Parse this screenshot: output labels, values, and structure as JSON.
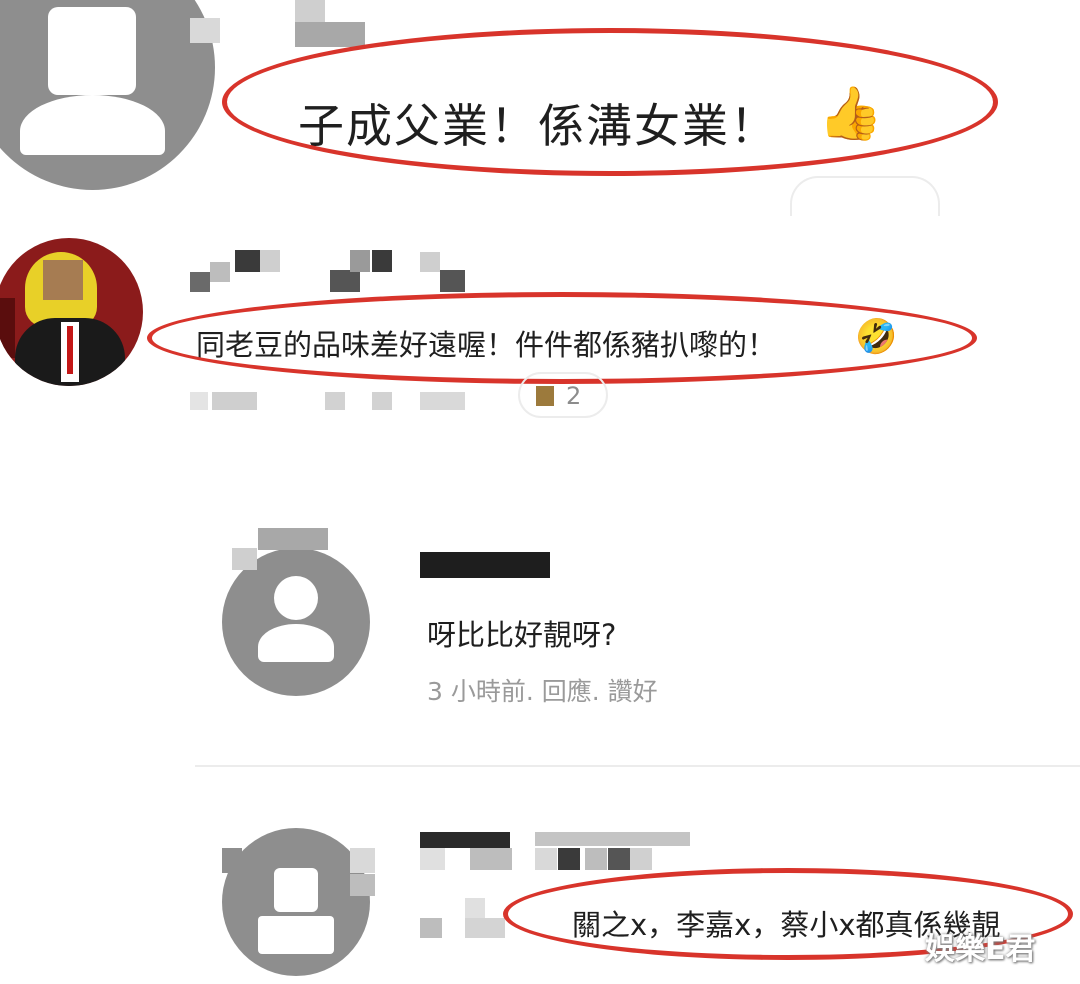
{
  "comments": [
    {
      "text": "子成父業！係溝女業！",
      "emoji": "👍"
    },
    {
      "text": "同老豆的品味差好遠喔！件件都係豬扒嚟的！",
      "emoji": "🤣",
      "reaction_count": "2"
    }
  ],
  "replies": [
    {
      "text": "呀比比好靚呀?",
      "meta": "3 小時前.  回應.  讚好"
    },
    {
      "text": "關之x，李嘉x，蔡小x都真係幾靚"
    }
  ],
  "watermark": "娛樂E君",
  "colors": {
    "highlight": "#d8342b",
    "avatar": "#8e8e8e",
    "meta": "#9a9a9a"
  }
}
